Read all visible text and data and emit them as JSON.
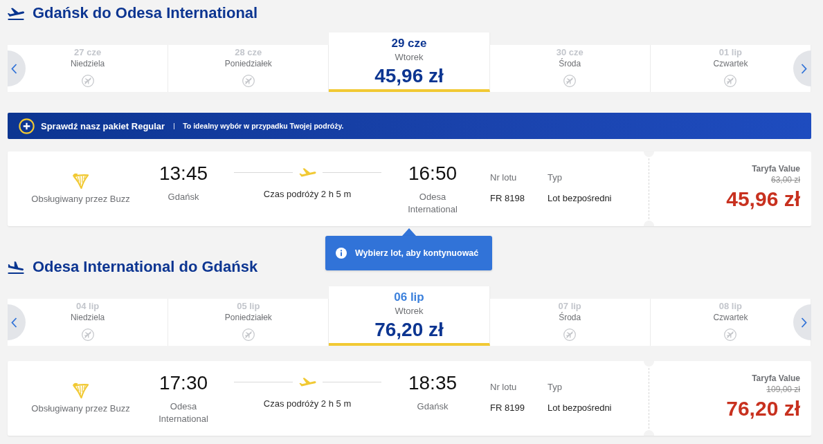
{
  "sections": [
    {
      "kind": "outbound",
      "title": "Gdańsk do Odesa International",
      "days": [
        {
          "date": "27 cze",
          "weekday": "Niedziela",
          "selected": false,
          "hovered": false,
          "available": false
        },
        {
          "date": "28 cze",
          "weekday": "Poniedziałek",
          "selected": false,
          "hovered": false,
          "available": false
        },
        {
          "date": "29 cze",
          "weekday": "Wtorek",
          "selected": true,
          "hovered": false,
          "available": true,
          "price": "45,96 zł"
        },
        {
          "date": "30 cze",
          "weekday": "Środa",
          "selected": false,
          "hovered": false,
          "available": false
        },
        {
          "date": "01 lip",
          "weekday": "Czwartek",
          "selected": false,
          "hovered": false,
          "available": false
        }
      ],
      "promo": {
        "title": "Sprawdź nasz pakiet Regular",
        "text": "To idealny wybór w przypadku Twojej podróży."
      },
      "flight": {
        "operator": "Obsługiwany przez Buzz",
        "departure_time": "13:45",
        "departure_airport": "Gdańsk",
        "duration": "Czas podróży 2 h 5 m",
        "arrival_time": "16:50",
        "arrival_airport": "Odesa International",
        "flight_number_label": "Nr lotu",
        "flight_number": "FR 8198",
        "type_label": "Typ",
        "type": "Lot bezpośredni",
        "fare_name": "Taryfa Value",
        "old_price": "63,00 zł",
        "price": "45,96 zł"
      },
      "tooltip": {
        "text": "Wybierz lot, aby kontynuować"
      }
    },
    {
      "kind": "return",
      "title": "Odesa International do Gdańsk",
      "days": [
        {
          "date": "04 lip",
          "weekday": "Niedziela",
          "selected": false,
          "hovered": false,
          "available": false
        },
        {
          "date": "05 lip",
          "weekday": "Poniedziałek",
          "selected": false,
          "hovered": false,
          "available": false
        },
        {
          "date": "06 lip",
          "weekday": "Wtorek",
          "selected": true,
          "hovered": true,
          "available": true,
          "price": "76,20 zł"
        },
        {
          "date": "07 lip",
          "weekday": "Środa",
          "selected": false,
          "hovered": false,
          "available": false
        },
        {
          "date": "08 lip",
          "weekday": "Czwartek",
          "selected": false,
          "hovered": false,
          "available": false
        }
      ],
      "flight": {
        "operator": "Obsługiwany przez Buzz",
        "departure_time": "17:30",
        "departure_airport": "Odesa International",
        "duration": "Czas podróży 2 h 5 m",
        "arrival_time": "18:35",
        "arrival_airport": "Gdańsk",
        "flight_number_label": "Nr lotu",
        "flight_number": "FR 8199",
        "type_label": "Typ",
        "type": "Lot bezpośredni",
        "fare_name": "Taryfa Value",
        "old_price": "109,00 zł",
        "price": "76,20 zł"
      }
    }
  ]
}
